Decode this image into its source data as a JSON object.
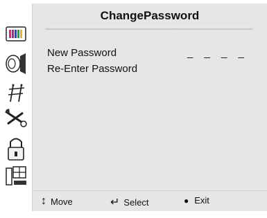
{
  "title": "ChangePassword",
  "fields": [
    {
      "label": "New Password",
      "value": "_ _ _ _"
    },
    {
      "label": "Re-Enter Password",
      "value": ""
    }
  ],
  "sidebar": {
    "icons": [
      {
        "name": "picture-icon"
      },
      {
        "name": "sound-icon"
      },
      {
        "name": "channel-antenna-icon"
      },
      {
        "name": "features-tools-icon"
      },
      {
        "name": "lock-icon"
      },
      {
        "name": "setup-pc-icon"
      }
    ]
  },
  "hints": {
    "move": "Move",
    "select": "Select",
    "exit": "Exit"
  },
  "colors": {
    "panel": "#e6e6e6",
    "text": "#111111"
  }
}
